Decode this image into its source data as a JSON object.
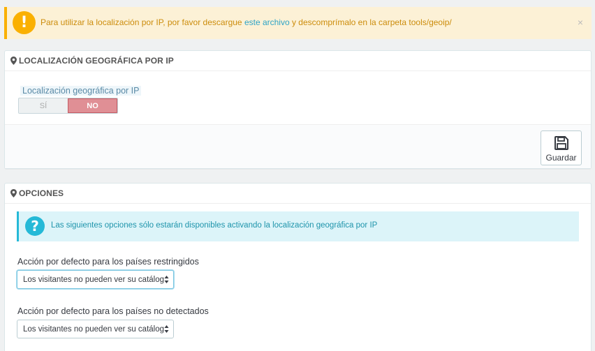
{
  "alert_warning": {
    "text_before": "Para utilizar la localización por IP, por favor descargue ",
    "link_text": "este archivo",
    "text_after": " y descomprímalo en la carpeta tools/geoip/",
    "close_glyph": "×",
    "icon": "exclamation-icon"
  },
  "geo_panel": {
    "title": "LOCALIZACIÓN GEOGRÁFICA POR IP",
    "field_label": "Localización geográfica por IP",
    "switch": {
      "yes_label": "SÍ",
      "no_label": "NO",
      "selected": "NO"
    },
    "save_label": "Guardar"
  },
  "options_panel": {
    "title": "OPCIONES",
    "info_text": "Las siguientes opciones sólo estarán disponibles activando la localización geográfica por IP",
    "restricted_label": "Acción por defecto para los países restringidos",
    "restricted_value": "Los visitantes no pueden ver su catálog",
    "undetected_label": "Acción por defecto para los países no detectados",
    "undetected_value": "Los visitantes no pueden ver su catálog"
  },
  "colors": {
    "warning_accent": "#fab000",
    "info_accent": "#25b9d7",
    "switch_off": "#e08f95"
  }
}
